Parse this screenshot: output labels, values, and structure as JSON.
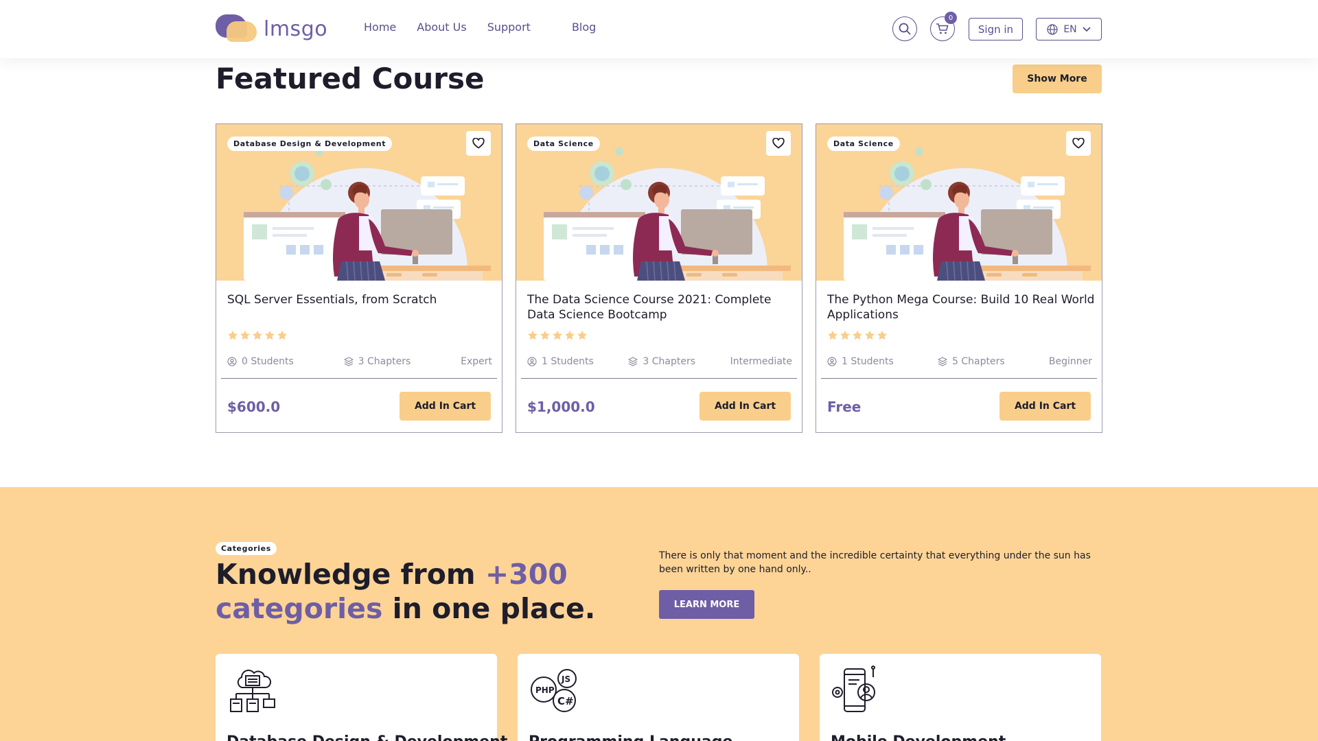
{
  "header": {
    "logo_text": "lmsgo",
    "nav": [
      "Home",
      "About Us",
      "Support",
      "Blog"
    ],
    "cart_count": "0",
    "signin_label": "Sign in",
    "language": "EN",
    "icons": [
      "search-icon",
      "cart-icon",
      "globe-icon",
      "chevron-down-icon"
    ]
  },
  "featured": {
    "title": "Featured Course",
    "show_more": "Show More",
    "cards": [
      {
        "tag": "Database Design & Development",
        "title": "SQL Server Essentials, from Scratch",
        "rating": 5,
        "students": "0  Students",
        "chapters": "3  Chapters",
        "level": "Expert",
        "price": "$600.0",
        "button": "Add In Cart"
      },
      {
        "tag": "Data Science",
        "title": "The Data Science Course 2021: Complete Data Science Bootcamp",
        "rating": 5,
        "students": "1  Students",
        "chapters": "3  Chapters",
        "level": "Intermediate",
        "price": "$1,000.0",
        "button": "Add In Cart"
      },
      {
        "tag": "Data Science",
        "title": "The Python Mega Course: Build 10 Real World Applications",
        "rating": 5,
        "students": "1  Students",
        "chapters": "5  Chapters",
        "level": "Beginner",
        "price": "Free",
        "button": "Add In Cart"
      }
    ]
  },
  "categories": {
    "badge": "Categories",
    "heading_part1": "Knowledge from ",
    "heading_accent1": "+300",
    "heading_accent2": "categories",
    "heading_part2": " in one place.",
    "description": "There is only that moment and the incredible certainty that everything under the sun has been written by one hand only..",
    "learn_more": "LEARN MORE",
    "items": [
      {
        "name": "Database Design & Development",
        "icon": "database-network-icon"
      },
      {
        "name": "Programming Language",
        "icon": "code-languages-icon"
      },
      {
        "name": "Mobile Development",
        "icon": "mobile-development-icon"
      }
    ]
  },
  "colors": {
    "brand_purple": "#6e5ea6",
    "accent_orange": "#f8ce8a",
    "section_bg": "#fdd496"
  }
}
